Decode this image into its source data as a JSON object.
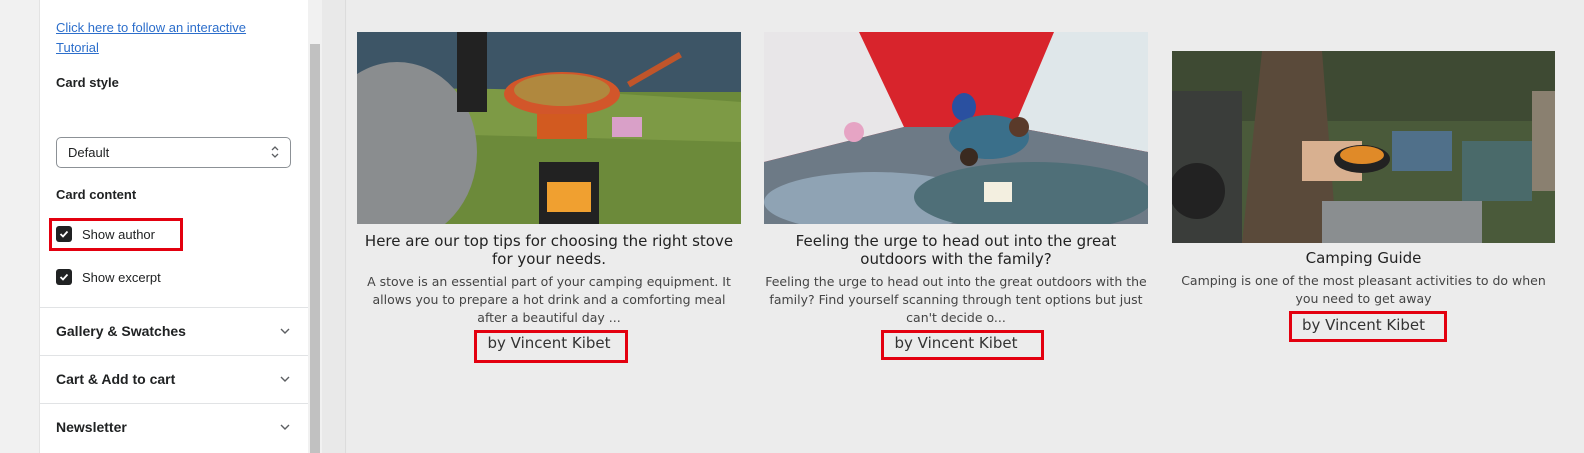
{
  "sidebar": {
    "tutorial_link": "Click here to follow an interactive Tutorial",
    "card_style_label": "Card style",
    "card_style_value": "Default",
    "card_content_label": "Card content",
    "show_author_label": "Show author",
    "show_author_checked": true,
    "show_excerpt_label": "Show excerpt",
    "show_excerpt_checked": true,
    "sections": [
      {
        "title": "Gallery & Swatches"
      },
      {
        "title": "Cart & Add to cart"
      },
      {
        "title": "Newsletter"
      }
    ]
  },
  "cards": [
    {
      "title": "Here are our top tips for choosing the right stove for your needs.",
      "excerpt": "A stove is an essential part of your camping equipment. It allows you to prepare a hot drink and a comforting meal after a beautiful day ...",
      "author": "by Vincent Kibet",
      "image_desc": "camping stove with frying pan on grass"
    },
    {
      "title": "Feeling the urge to head out into the great outdoors with the family?",
      "excerpt": "Feeling the urge to head out into the great outdoors with the family? Find yourself scanning through tent options but just can't decide o...",
      "author": "by Vincent Kibet",
      "image_desc": "family reading inside a red tent"
    },
    {
      "title": "Camping Guide",
      "excerpt": "Camping is one of the most pleasant activities to do when you need to get away",
      "author": "by Vincent Kibet",
      "image_desc": "person cooking on camp stove next to truck"
    }
  ],
  "colors": {
    "highlight": "#e3000f",
    "link": "#2c6ecb"
  }
}
